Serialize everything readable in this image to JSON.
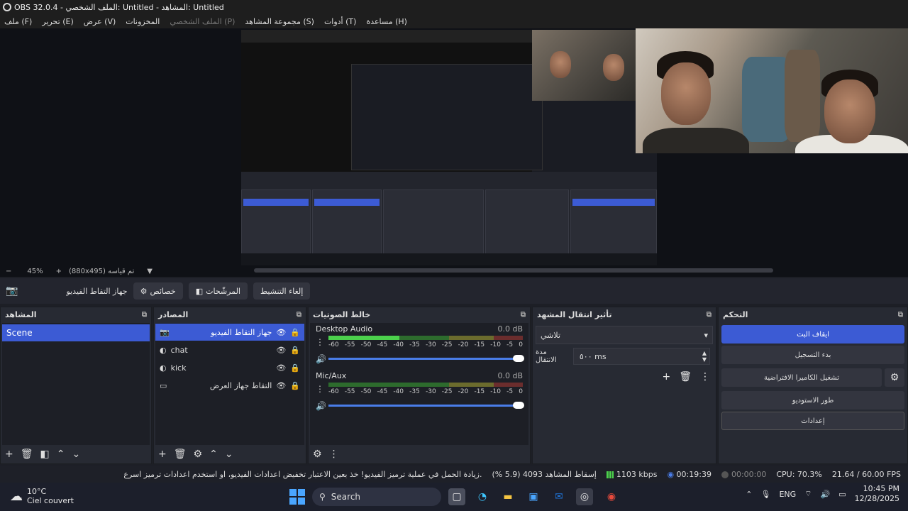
{
  "window": {
    "title": "OBS 32.0.4 - الملف الشخصي: Untitled - المشاهد: Untitled"
  },
  "menu": {
    "file": "ملف (F)",
    "edit": "تحرير (E)",
    "view": "عرض (V)",
    "docks": "المخزونات",
    "profile": "الملف الشخصي (P)",
    "scene_collection": "مجموعة المشاهد (S)",
    "tools": "أدوات (T)",
    "help": "مساعدة (H)"
  },
  "preview": {
    "zoom_out": "−",
    "zoom": "45%",
    "zoom_in": "+",
    "scale_label": "(880x495) تم قياسه",
    "menu_arrow": "▼"
  },
  "context": {
    "source_icon": "camera-icon",
    "source_name": "جهاز التقاط الفيديو",
    "properties": "خصائص",
    "filters": "المرشّحات",
    "deactivate": "إلغاء التنشيط"
  },
  "scenes": {
    "title": "المشاهد",
    "items": [
      "Scene"
    ]
  },
  "sources": {
    "title": "المصادر",
    "items": [
      {
        "name": "جهاز التقاط الفيديو",
        "icon": "camera-icon",
        "rtl": true
      },
      {
        "name": "chat",
        "icon": "browser-icon",
        "rtl": false
      },
      {
        "name": "kick",
        "icon": "browser-icon",
        "rtl": false
      },
      {
        "name": "التقاط جهاز العرض",
        "icon": "monitor-icon",
        "rtl": true
      }
    ]
  },
  "mixer": {
    "title": "خالط الصوتيات",
    "tracks": [
      {
        "name": "Desktop Audio",
        "db": "0.0 dB",
        "level": 0.38
      },
      {
        "name": "Mic/Aux",
        "db": "0.0 dB",
        "level": 0.0
      }
    ],
    "ticks": [
      "-60",
      "-55",
      "-50",
      "-45",
      "-40",
      "-35",
      "-30",
      "-25",
      "-20",
      "-15",
      "-10",
      "-5",
      "0"
    ]
  },
  "transitions": {
    "title": "تأثير انتقال المشهد",
    "selected": "تلاشي",
    "duration_label": "مدة الانتقال",
    "duration": "٥٠٠ ms"
  },
  "controls": {
    "title": "التحكم",
    "stop_stream": "ايقاف البث",
    "start_record": "بدء التسجيل",
    "virtual_cam": "تشغيل الكاميرا الافتراضية",
    "studio_mode": "طور الاستوديو",
    "settings": "إعدادات"
  },
  "status": {
    "message": "زيادة الحمل في عملية ترميز الفيديو! خذ بعين الاعتبار تخفيض اعدادات الفيديو، او استخدم اعدادات ترميز اسرع.",
    "dropped": "إسقاط المشاهد 4093 (5.9 %)",
    "bitrate": "1103 kbps",
    "stream_time": "00:19:39",
    "record_time": "00:00:00",
    "cpu": "CPU: 70.3%",
    "fps": "21.64 / 60.00 FPS"
  },
  "taskbar": {
    "temp": "10°C",
    "weather": "Ciel couvert",
    "search": "Search",
    "lang": "ENG",
    "time": "10:45 PM",
    "date": "12/28/2025"
  },
  "colors": {
    "accent": "#3c5bd4",
    "meter_green": "#4cd14c"
  }
}
